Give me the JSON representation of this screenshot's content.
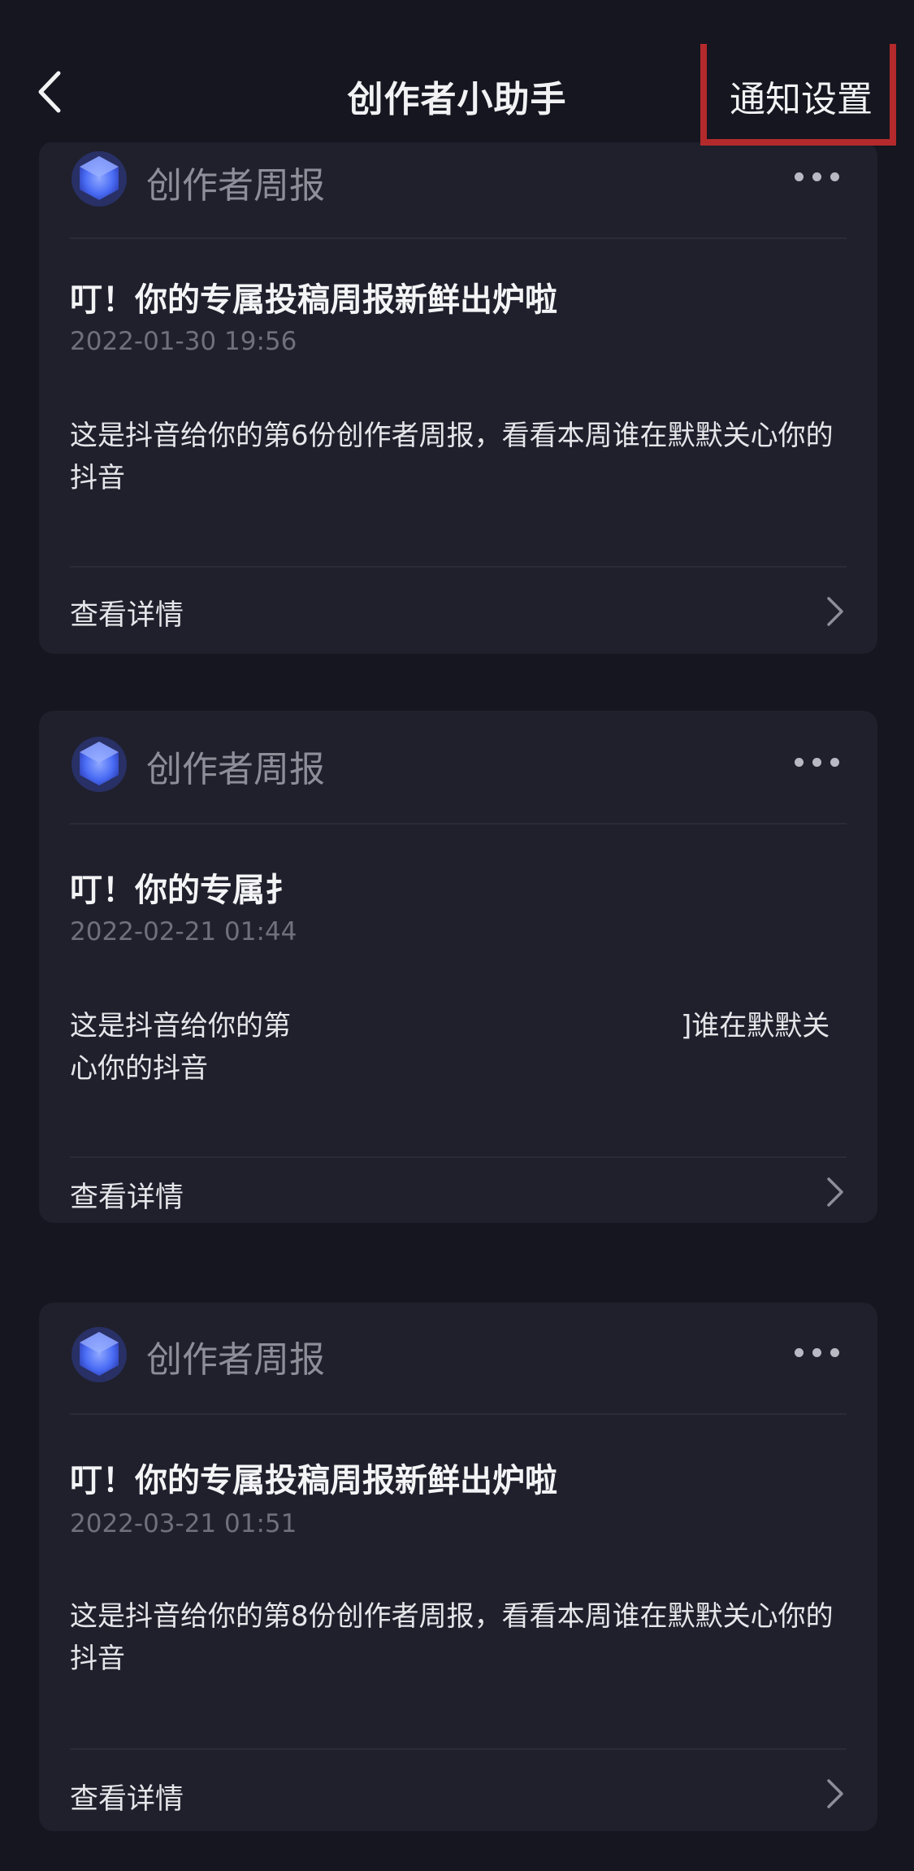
{
  "header": {
    "title": "创作者小助手",
    "settings_label": "通知设置"
  },
  "cards": [
    {
      "sender": "创作者周报",
      "title": "叮！你的专属投稿周报新鲜出炉啦",
      "date": "2022-01-30 19:56",
      "body": "这是抖音给你的第6份创作者周报，看看本周谁在默默关心你的抖音",
      "link_label": "查看详情"
    },
    {
      "sender": "创作者周报",
      "title": "叮！你的专属扌",
      "date": "2022-02-21 01:44",
      "body_left": "这是抖音给你的第",
      "body_right": "]谁在默默关",
      "body_line2": "心你的抖音",
      "link_label": "查看详情"
    },
    {
      "sender": "创作者周报",
      "title": "叮！你的专属投稿周报新鲜出炉啦",
      "date": "2022-03-21 01:51",
      "body": "这是抖音给你的第8份创作者周报，看看本周谁在默默关心你的抖音",
      "link_label": "查看详情"
    }
  ],
  "icons": {
    "back": "chevron-left-icon",
    "avatar": "hexagon-cube-icon",
    "more": "more-dots-icon",
    "chevron": "chevron-right-icon"
  },
  "colors": {
    "background": "#15161f",
    "card": "#1f202c",
    "highlight": "#b42a2c",
    "avatar_blue": "#4a6cf5"
  }
}
